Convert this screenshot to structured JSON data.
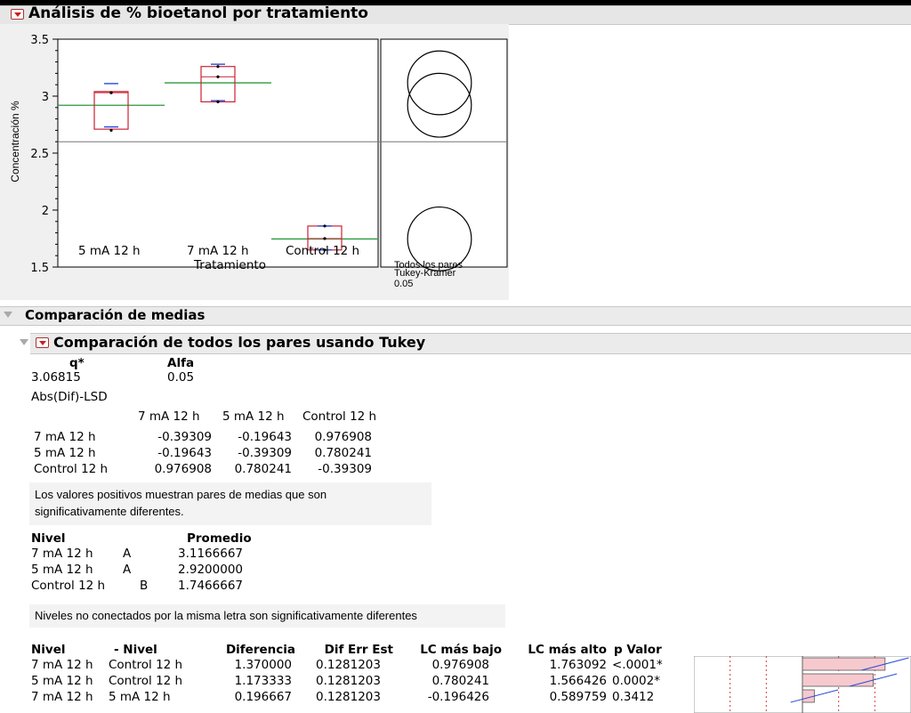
{
  "title": "Análisis de % bioetanol por tratamiento",
  "chart_data": {
    "type": "box",
    "ylabel": "Concentración %",
    "xlabel": "Tratamiento",
    "ylim": [
      1.5,
      3.5
    ],
    "yticks": [
      "1.5",
      "2",
      "2.5",
      "3",
      "3.5"
    ],
    "categories": [
      "5 mA 12 h",
      "7 mA 12 h",
      "Control 12 h"
    ],
    "grand_mean": 2.6,
    "groups": [
      {
        "name": "5 mA 12 h",
        "mean": 2.92,
        "q1": 2.71,
        "median": 3.03,
        "q3": 3.04,
        "min": 2.7,
        "max": 3.03,
        "ci_low": 2.73,
        "ci_high": 3.11
      },
      {
        "name": "7 mA 12 h",
        "mean": 3.1166667,
        "q1": 2.95,
        "median": 3.17,
        "q3": 3.26,
        "min": 2.95,
        "max": 3.26,
        "ci_low": 2.96,
        "ci_high": 3.28
      },
      {
        "name": "Control 12 h",
        "mean": 1.7466667,
        "q1": 1.65,
        "median": 1.75,
        "q3": 1.86,
        "min": 1.65,
        "max": 1.86,
        "ci_low": 1.65,
        "ci_high": 1.86
      }
    ],
    "circles_panel": {
      "label1": "Todos los pares",
      "label2": "Tukey-Kramer",
      "label3": "0.05"
    }
  },
  "comparacion": {
    "title": "Comparación de medias",
    "tukey_title": "Comparación de todos los pares usando Tukey",
    "q_header": "q*",
    "alfa_header": "Alfa",
    "q_value": "3.06815",
    "alfa_value": "0.05",
    "lsd_title": "Abs(Dif)-LSD",
    "lsd_cols": [
      "7 mA 12 h",
      "5 mA 12 h",
      "Control 12 h"
    ],
    "lsd_rows": [
      {
        "label": "7 mA 12 h",
        "values": [
          "-0.39309",
          "-0.19643",
          "0.976908"
        ]
      },
      {
        "label": "5 mA 12 h",
        "values": [
          "-0.19643",
          "-0.39309",
          "0.780241"
        ]
      },
      {
        "label": "Control 12 h",
        "values": [
          "0.976908",
          "0.780241",
          "-0.39309"
        ]
      }
    ],
    "note1_line1": "Los valores positivos muestran pares de medias que son",
    "note1_line2": "significativamente diferentes.",
    "nivel_header": "Nivel",
    "promedio_header": "Promedio",
    "levels": [
      {
        "label": "7 mA 12 h",
        "letter": "A",
        "mean": "3.1166667"
      },
      {
        "label": "5 mA 12 h",
        "letter": "A",
        "mean": "2.9200000"
      },
      {
        "label": "Control 12 h",
        "letter": "B",
        "mean": "1.7466667"
      }
    ],
    "note2": "Niveles no conectados por la misma letra son significativamente diferentes",
    "diff_headers": [
      "Nivel",
      "- Nivel",
      "Diferencia",
      "Dif Err Est",
      "LC más bajo",
      "LC más alto",
      "p Valor"
    ],
    "diffs": [
      {
        "a": "7 mA 12 h",
        "b": "Control 12 h",
        "dif": "1.370000",
        "err": "0.1281203",
        "lo": "0.976908",
        "hi": "1.763092",
        "p": "<.0001*",
        "dif_value": 1.37,
        "lo_value": 0.976908,
        "hi_value": 1.763092
      },
      {
        "a": "5 mA 12 h",
        "b": "Control 12 h",
        "dif": "1.173333",
        "err": "0.1281203",
        "lo": "0.780241",
        "hi": "1.566426",
        "p": "0.0002*",
        "dif_value": 1.173333,
        "lo_value": 0.780241,
        "hi_value": 1.566426
      },
      {
        "a": "7 mA 12 h",
        "b": "5 mA 12 h",
        "dif": "0.196667",
        "err": "0.1281203",
        "lo": "-0.196426",
        "hi": "0.589759",
        "p": "0.3412",
        "dif_value": 0.196667,
        "lo_value": -0.196426,
        "hi_value": 0.589759
      }
    ]
  },
  "colors": {
    "box": "#cc2233",
    "mean_line": "#2a9a3a",
    "ci": "#2a4bd8",
    "bar_fill": "#f6c9ce"
  }
}
